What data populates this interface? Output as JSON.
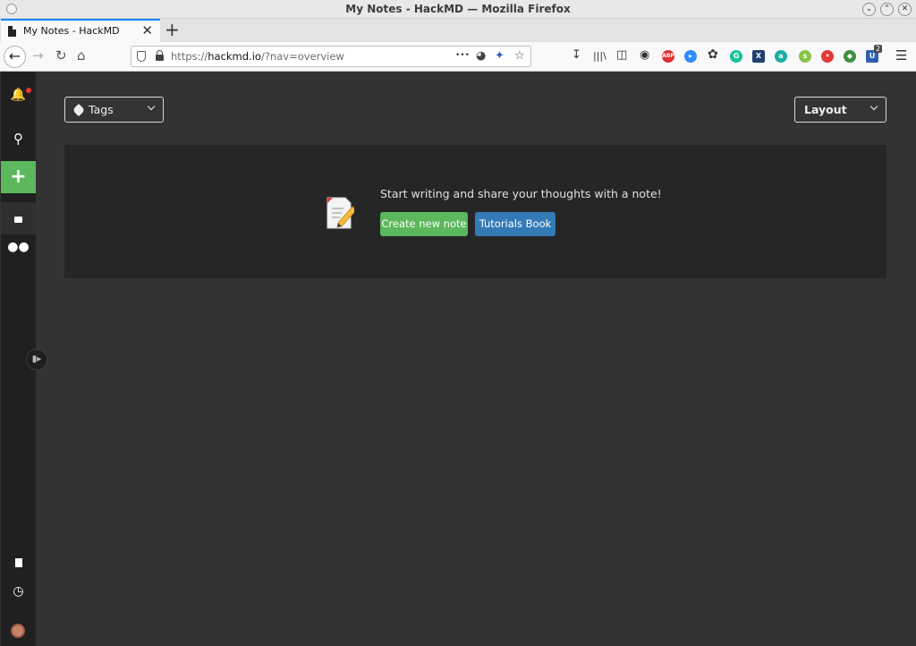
{
  "window": {
    "title": "My Notes - HackMD — Mozilla Firefox"
  },
  "browser": {
    "tab": {
      "label": "My Notes - HackMD",
      "close": "✕"
    },
    "new_tab": "+",
    "url_prefix": "https://",
    "url_host": "hackmd.io",
    "url_path": "/?nav=overview",
    "page_actions": "•••",
    "extensions": [
      {
        "name": "abp-icon",
        "text": "ABP",
        "color": "#e03030"
      },
      {
        "name": "zoom-icon",
        "text": "▸",
        "color": "#2d8cff"
      },
      {
        "name": "grammarly-icon",
        "text": "G",
        "color": "#15c39a"
      },
      {
        "name": "xmarks-icon",
        "text": "X",
        "color": "#1f3f6f"
      },
      {
        "name": "amazon-assistant-icon",
        "text": "a",
        "color": "#1aae9f"
      },
      {
        "name": "greasemonkey-icon",
        "text": "s",
        "color": "#8bc34a"
      },
      {
        "name": "lastpass-icon",
        "text": "•",
        "color": "#e53935"
      },
      {
        "name": "globe-ext-icon",
        "text": "◆",
        "color": "#3f8f3f"
      },
      {
        "name": "ublock-icon",
        "text": "U",
        "color": "#2f5fb0"
      }
    ],
    "ublock_badge": "2"
  },
  "sidebar": {
    "new_note": "+"
  },
  "toolbar": {
    "tags_label": "Tags",
    "layout_label": "Layout"
  },
  "empty_state": {
    "message": "Start writing and share your thoughts with a note!",
    "create_button": "Create new note",
    "tutorials_button": "Tutorials Book"
  },
  "colors": {
    "accent_green": "#5cb85c",
    "accent_blue": "#337ab7",
    "background": "#333333",
    "sidebar": "#202020"
  }
}
